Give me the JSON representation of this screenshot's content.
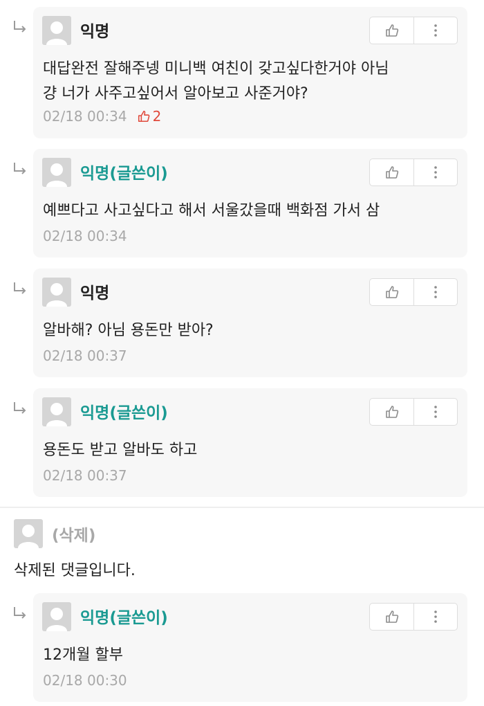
{
  "comments": [
    {
      "author": "익명",
      "is_writer": false,
      "text": "대답완전 잘해주넹 미니백 여친이 갖고싶다한거야 아님\n걍 너가 사주고싶어서 알아보고 사준거야?",
      "date": "02/18 00:34",
      "likes": "2"
    },
    {
      "author": "익명(글쓴이)",
      "is_writer": true,
      "text": "예쁘다고 사고싶다고 해서 서울갔을때 백화점 가서 삼",
      "date": "02/18 00:34"
    },
    {
      "author": "익명",
      "is_writer": false,
      "text": "알바해? 아님 용돈만 받아?",
      "date": "02/18 00:37"
    },
    {
      "author": "익명(글쓴이)",
      "is_writer": true,
      "text": "용돈도 받고 알바도 하고",
      "date": "02/18 00:37"
    }
  ],
  "deleted_comment": {
    "author": "(삭제)",
    "text": "삭제된 댓글입니다."
  },
  "last_reply": {
    "author": "익명(글쓴이)",
    "is_writer": true,
    "text": "12개월 할부",
    "date": "02/18 00:30"
  },
  "colors": {
    "writer": "#1a9a92",
    "like": "#e0493b",
    "meta": "#a8a8a8",
    "card_bg": "#f7f7f7"
  },
  "icons": {
    "reply": "reply-arrow-icon",
    "like": "thumbs-up-icon",
    "more": "more-vertical-icon",
    "avatar": "default-avatar-icon"
  }
}
